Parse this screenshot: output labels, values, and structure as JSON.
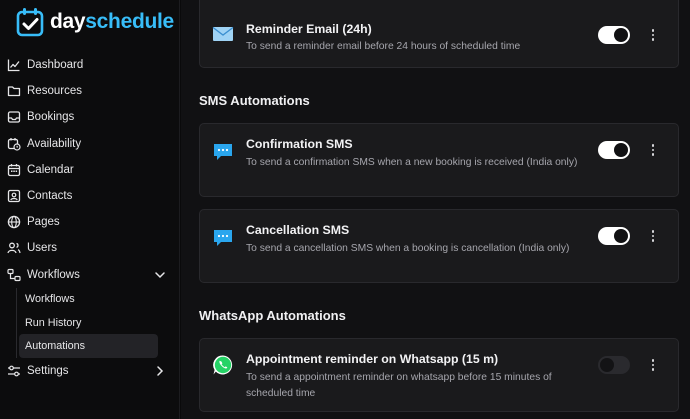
{
  "brand": {
    "part1": "day",
    "part2": "schedule",
    "accent": "#38bdf8"
  },
  "sidebar": {
    "items": [
      {
        "label": "Dashboard",
        "icon": "chart-line-icon"
      },
      {
        "label": "Resources",
        "icon": "folder-icon"
      },
      {
        "label": "Bookings",
        "icon": "inbox-icon"
      },
      {
        "label": "Availability",
        "icon": "calendar-clock-icon"
      },
      {
        "label": "Calendar",
        "icon": "calendar-icon"
      },
      {
        "label": "Contacts",
        "icon": "contact-card-icon"
      },
      {
        "label": "Pages",
        "icon": "globe-icon"
      },
      {
        "label": "Users",
        "icon": "users-icon"
      },
      {
        "label": "Workflows",
        "icon": "workflow-icon",
        "expanded": true
      }
    ],
    "workflow_sub": [
      "Workflows",
      "Run History",
      "Automations"
    ],
    "active_sub": "Automations",
    "settings": {
      "label": "Settings",
      "icon": "settings-sliders-icon"
    }
  },
  "main": {
    "reminder_email": {
      "title": "Reminder Email (24h)",
      "desc": "To send a reminder email before 24 hours of scheduled time",
      "enabled": true
    },
    "sms_section": "SMS Automations",
    "confirmation_sms": {
      "title": "Confirmation SMS",
      "desc": "To send a confirmation SMS when a new booking is received (India only)",
      "enabled": true
    },
    "cancellation_sms": {
      "title": "Cancellation SMS",
      "desc": "To send a cancellation SMS when a booking is cancellation (India only)",
      "enabled": true
    },
    "whatsapp_section": "WhatsApp Automations",
    "whatsapp_reminder": {
      "title": "Appointment reminder on Whatsapp (15 m)",
      "desc": "To send a appointment reminder on whatsapp before 15 minutes of scheduled time",
      "enabled": false
    }
  }
}
